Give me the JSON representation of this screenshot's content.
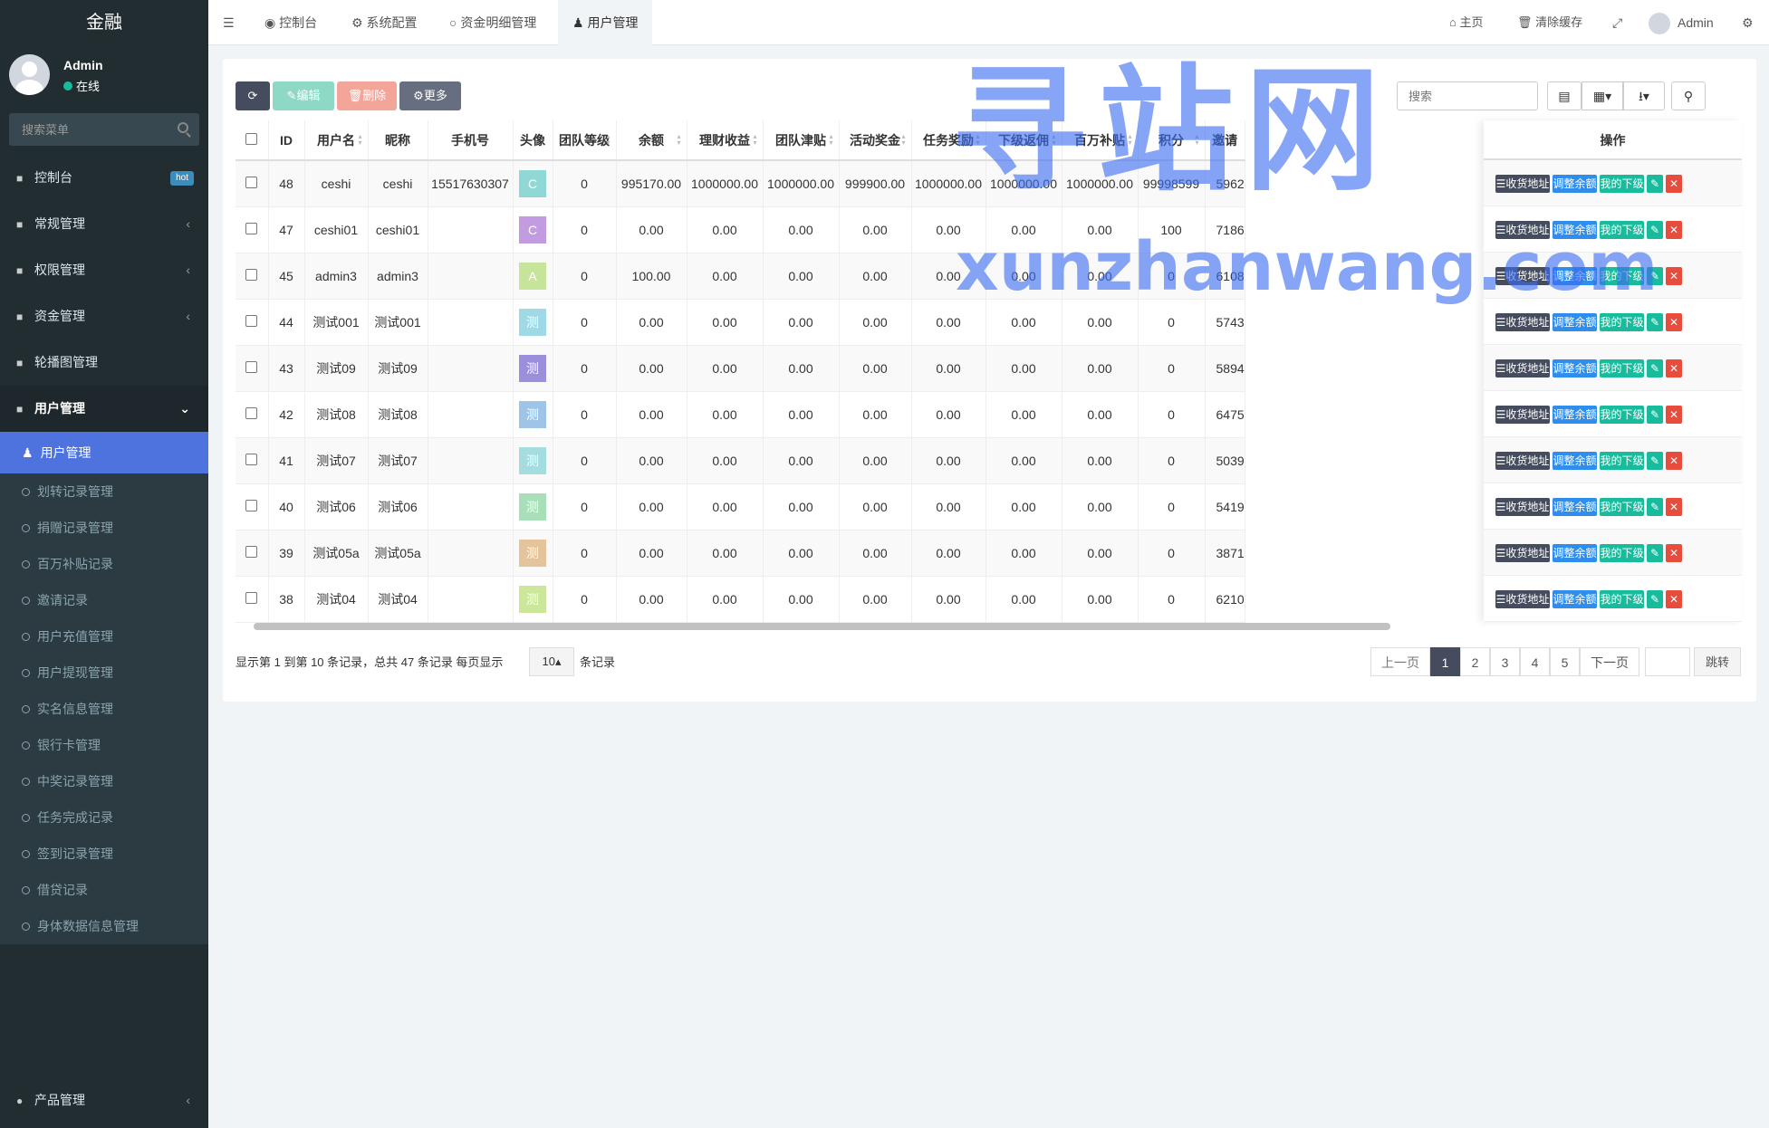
{
  "app": {
    "title": "金融"
  },
  "user": {
    "name": "Admin",
    "status": "在线"
  },
  "sidebar": {
    "search_placeholder": "搜索菜单",
    "menu": [
      {
        "label": "控制台",
        "icon": "dashboard-icon",
        "badge": "hot"
      },
      {
        "label": "常规管理",
        "icon": "cogs-icon"
      },
      {
        "label": "权限管理",
        "icon": "group-icon"
      },
      {
        "label": "资金管理",
        "icon": "money-icon"
      },
      {
        "label": "轮播图管理",
        "icon": "image-icon"
      },
      {
        "label": "用户管理",
        "icon": "user-circle-icon"
      }
    ],
    "sub": [
      "用户管理",
      "划转记录管理",
      "捐赠记录管理",
      "百万补贴记录",
      "邀请记录",
      "用户充值管理",
      "用户提现管理",
      "实名信息管理",
      "银行卡管理",
      "中奖记录管理",
      "任务完成记录",
      "签到记录管理",
      "借贷记录",
      "身体数据信息管理"
    ],
    "bottom": {
      "label": "产品管理",
      "icon": "product-icon"
    }
  },
  "topbar": {
    "tabs": [
      "控制台",
      "系统配置",
      "资金明细管理",
      "用户管理"
    ],
    "right": [
      "主页",
      "清除缓存",
      "Admin"
    ]
  },
  "toolbar": {
    "edit": "编辑",
    "delete": "删除",
    "more": "更多",
    "search_placeholder": "搜索"
  },
  "table": {
    "headers": [
      "ID",
      "用户名",
      "昵称",
      "手机号",
      "头像",
      "团队等级",
      "余额",
      "理财收益",
      "团队津贴",
      "活动奖金",
      "任务奖励",
      "下级返佣",
      "百万补贴",
      "积分",
      "邀请"
    ],
    "ops_header": "操作",
    "ops": [
      "收货地址",
      "调整余额",
      "我的下级"
    ],
    "rows": [
      [
        "48",
        "ceshi",
        "ceshi",
        "15517630307",
        "C",
        "0",
        "995170.00",
        "1000000.00",
        "1000000.00",
        "999900.00",
        "1000000.00",
        "1000000.00",
        "1000000.00",
        "99998599",
        "5962"
      ],
      [
        "47",
        "ceshi01",
        "ceshi01",
        "",
        "C",
        "0",
        "0.00",
        "0.00",
        "0.00",
        "0.00",
        "0.00",
        "0.00",
        "0.00",
        "100",
        "7186"
      ],
      [
        "45",
        "admin3",
        "admin3",
        "",
        "A",
        "0",
        "100.00",
        "0.00",
        "0.00",
        "0.00",
        "0.00",
        "0.00",
        "0.00",
        "0",
        "6108"
      ],
      [
        "44",
        "测试001",
        "测试001",
        "",
        "测",
        "0",
        "0.00",
        "0.00",
        "0.00",
        "0.00",
        "0.00",
        "0.00",
        "0.00",
        "0",
        "5743"
      ],
      [
        "43",
        "测试09",
        "测试09",
        "",
        "测",
        "0",
        "0.00",
        "0.00",
        "0.00",
        "0.00",
        "0.00",
        "0.00",
        "0.00",
        "0",
        "5894"
      ],
      [
        "42",
        "测试08",
        "测试08",
        "",
        "测",
        "0",
        "0.00",
        "0.00",
        "0.00",
        "0.00",
        "0.00",
        "0.00",
        "0.00",
        "0",
        "6475"
      ],
      [
        "41",
        "测试07",
        "测试07",
        "",
        "测",
        "0",
        "0.00",
        "0.00",
        "0.00",
        "0.00",
        "0.00",
        "0.00",
        "0.00",
        "0",
        "5039"
      ],
      [
        "40",
        "测试06",
        "测试06",
        "",
        "测",
        "0",
        "0.00",
        "0.00",
        "0.00",
        "0.00",
        "0.00",
        "0.00",
        "0.00",
        "0",
        "5419"
      ],
      [
        "39",
        "测试05a",
        "测试05a",
        "",
        "测",
        "0",
        "0.00",
        "0.00",
        "0.00",
        "0.00",
        "0.00",
        "0.00",
        "0.00",
        "0",
        "3871"
      ],
      [
        "38",
        "测试04",
        "测试04",
        "",
        "测",
        "0",
        "0.00",
        "0.00",
        "0.00",
        "0.00",
        "0.00",
        "0.00",
        "0.00",
        "0",
        "6210"
      ]
    ],
    "avatar_colors": [
      "#8fd8d6",
      "#c39be0",
      "#c7e59a",
      "#9fd9e6",
      "#9b8fdc",
      "#9ec5e8",
      "#a3dde0",
      "#a8dfb8",
      "#e6c49b",
      "#cde79a"
    ]
  },
  "footer": {
    "summary": "显示第 1 到第 10 条记录，总共 47 条记录 每页显示",
    "page_size": "10",
    "suffix": "条记录",
    "prev": "上一页",
    "next": "下一页",
    "jump": "跳转",
    "pages": [
      "1",
      "2",
      "3",
      "4",
      "5"
    ]
  },
  "watermark": {
    "cn": "寻站网",
    "en": "xunzhanwang.com"
  },
  "colors": {
    "sidebar": "#222d32",
    "active": "#4e73df",
    "green": "#18bc9c",
    "blue": "#2e8ded",
    "red": "#e74c3c",
    "dark": "#444c5e"
  }
}
